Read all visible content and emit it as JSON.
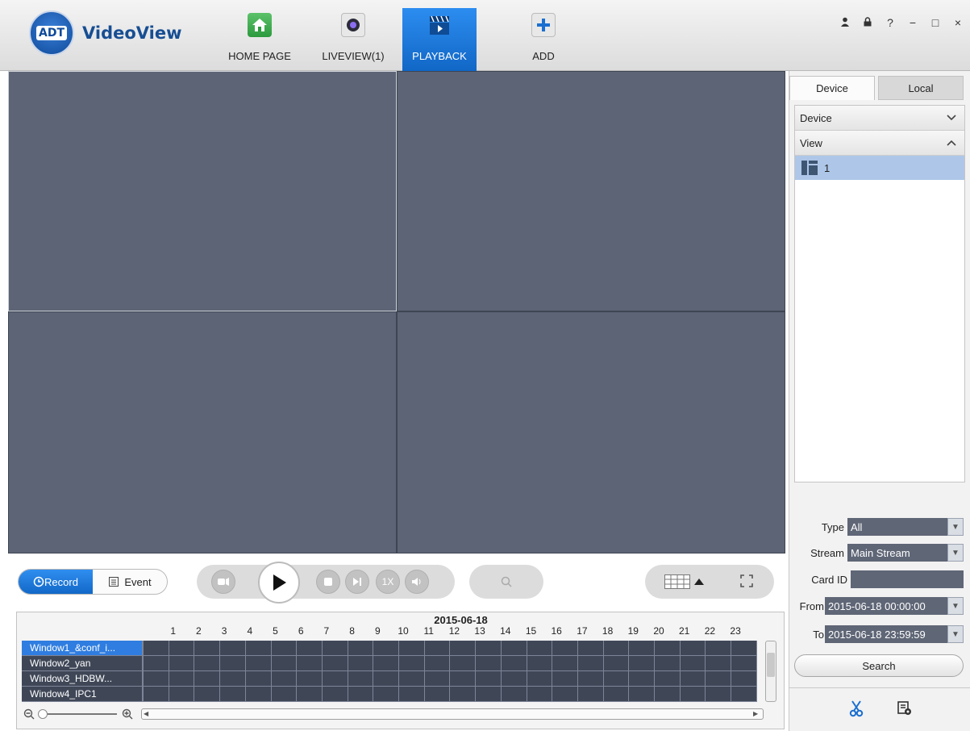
{
  "app": {
    "brand_badge": "ADT",
    "brand_name": "VideoView"
  },
  "nav": {
    "tabs": [
      {
        "label": "HOME PAGE",
        "icon": "home-icon"
      },
      {
        "label": "LIVEVIEW(1)",
        "icon": "camera-icon"
      },
      {
        "label": "PLAYBACK",
        "icon": "playback-clapper-icon",
        "active": true
      },
      {
        "label": "ADD",
        "icon": "plus-icon"
      }
    ]
  },
  "window_controls": [
    "user-icon",
    "lock-icon",
    "help-icon",
    "minimize-icon",
    "maximize-icon",
    "close-icon"
  ],
  "window_controls_glyphs": {
    "help": "?",
    "minimize": "−",
    "maximize": "□",
    "close": "×"
  },
  "right_panel": {
    "tabs": {
      "device": "Device",
      "local": "Local"
    },
    "tree": {
      "device_header": "Device",
      "view_header": "View",
      "view_item": "1"
    },
    "filters": {
      "type_label": "Type",
      "type_value": "All",
      "stream_label": "Stream",
      "stream_value": "Main Stream",
      "card_id_label": "Card ID",
      "card_id_value": "",
      "from_label": "From",
      "from_value": "2015-06-18 00:00:00",
      "to_label": "To",
      "to_value": "2015-06-18 23:59:59"
    },
    "search_label": "Search",
    "tools": [
      "scissors-icon",
      "record-file-icon"
    ]
  },
  "controls": {
    "record_label": "Record",
    "event_label": "Event",
    "speed_label": "1X"
  },
  "timeline": {
    "date": "2015-06-18",
    "hours": [
      "1",
      "2",
      "3",
      "4",
      "5",
      "6",
      "7",
      "8",
      "9",
      "10",
      "11",
      "12",
      "13",
      "14",
      "15",
      "16",
      "17",
      "18",
      "19",
      "20",
      "21",
      "22",
      "23"
    ],
    "windows": [
      "Window1_&conf_i...",
      "Window2_yan",
      "Window3_HDBW...",
      "Window4_IPC1"
    ]
  },
  "colors": {
    "accent": "#1a6fd0",
    "video_bg": "#5c6475",
    "timeline_bg": "#3f4757"
  }
}
